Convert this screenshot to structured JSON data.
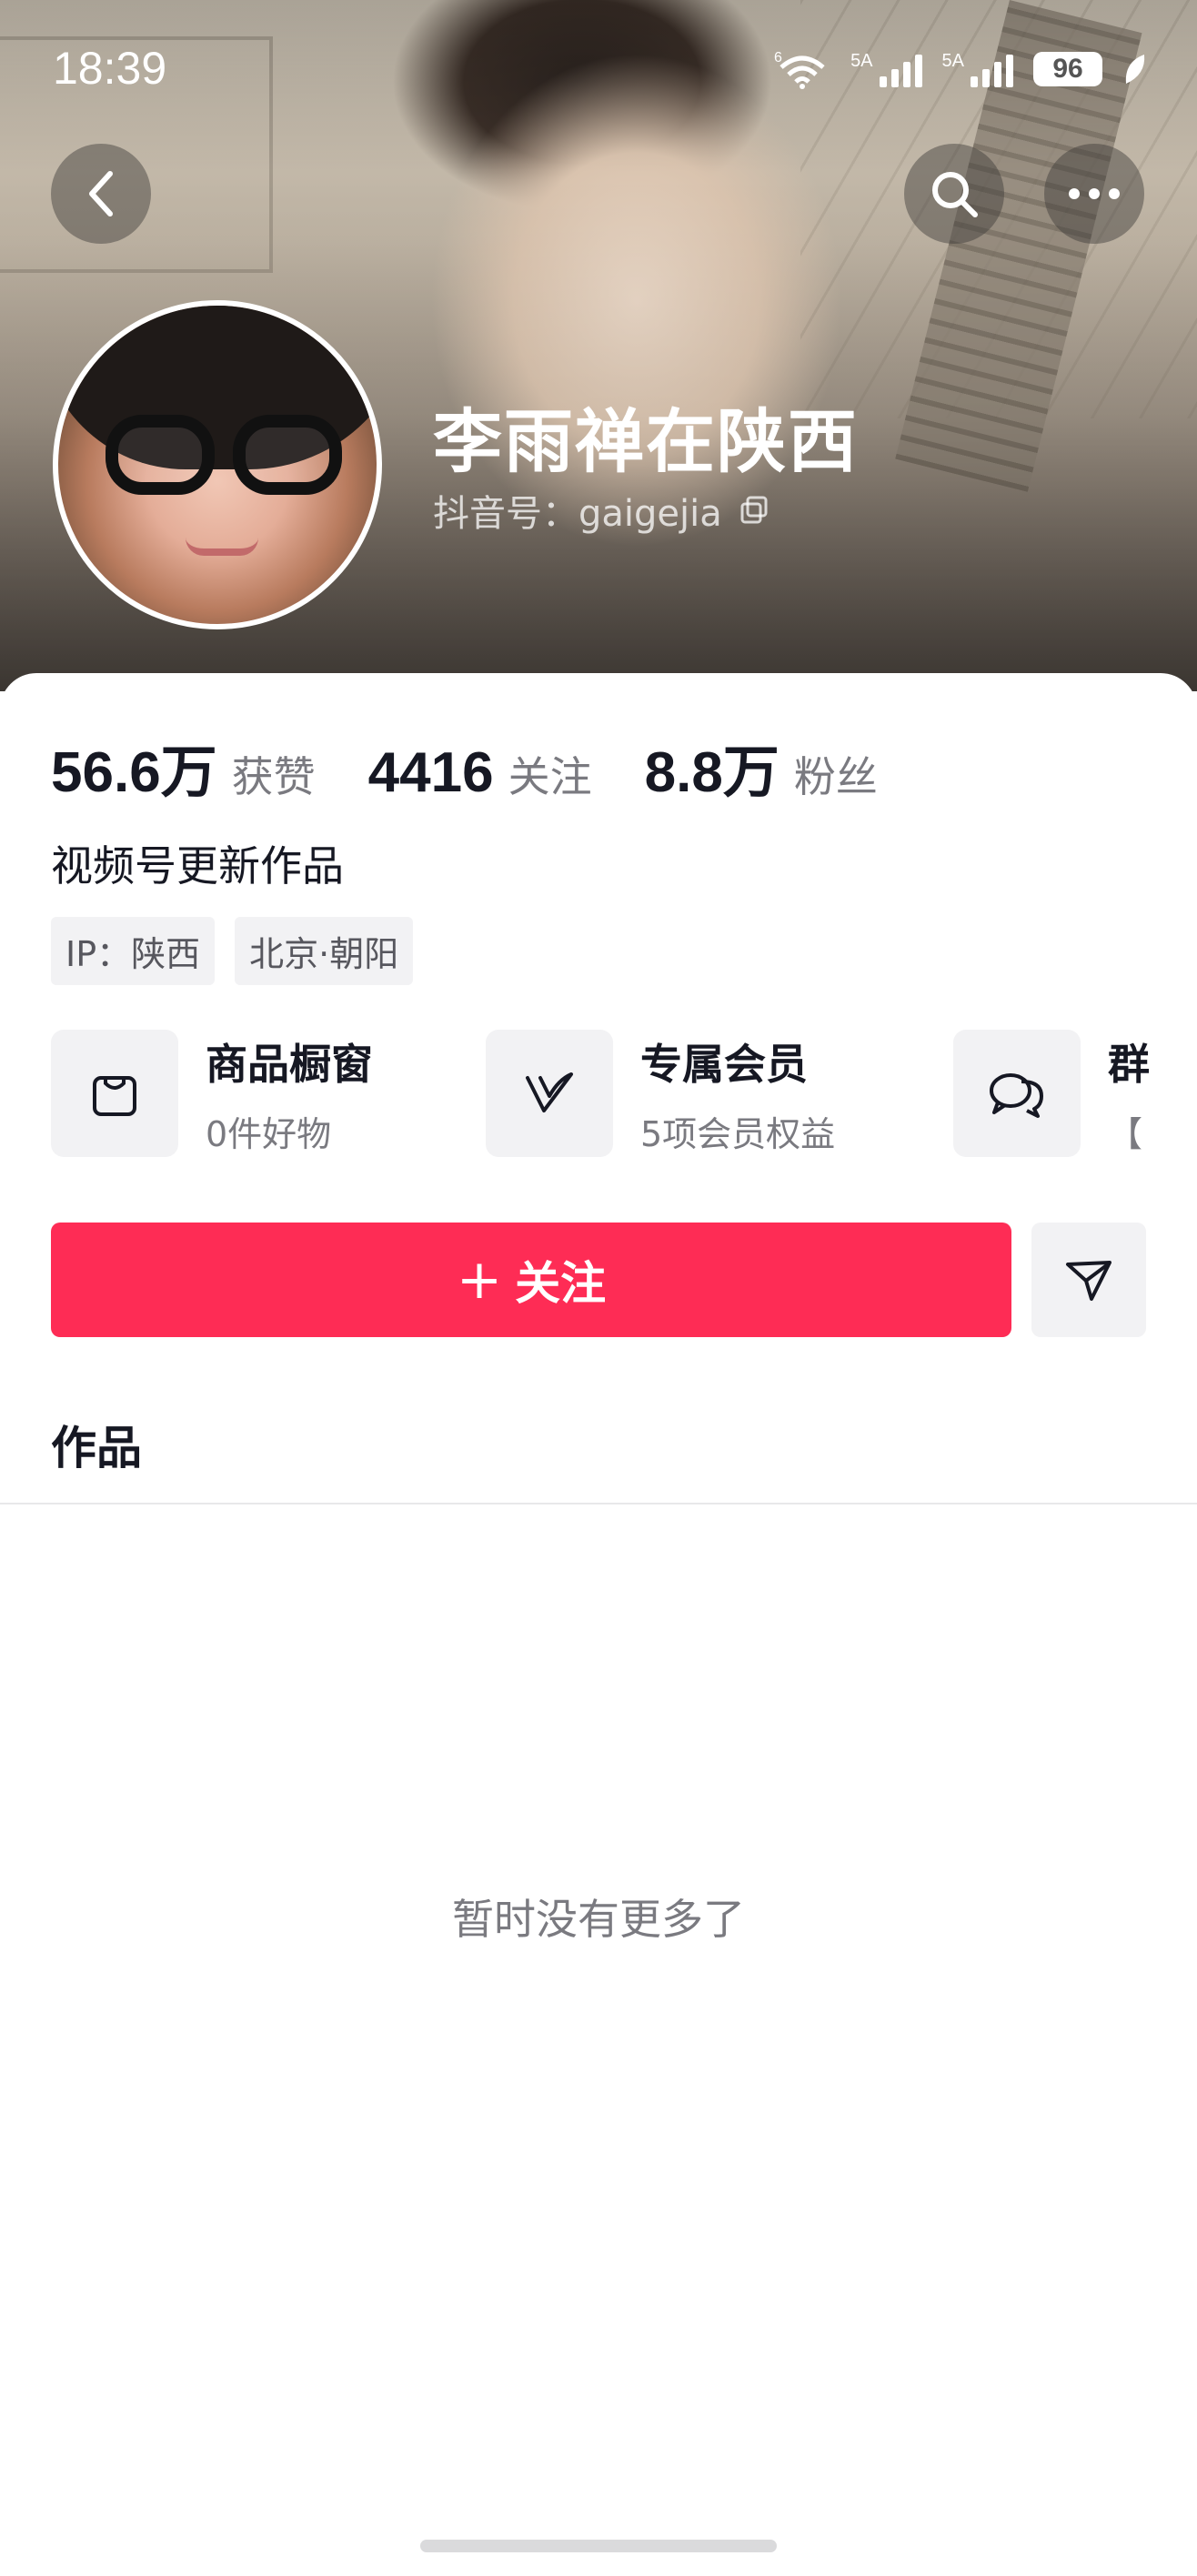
{
  "status_bar": {
    "time": "18:39",
    "wifi_label": "6",
    "signal1_label": "5A",
    "signal2_label": "5A",
    "battery": "96"
  },
  "nav": {
    "back_icon": "back-chevron-icon",
    "search_icon": "search-icon",
    "more_icon": "more-dots-icon"
  },
  "profile": {
    "name": "李雨禅在陕西",
    "handle": "抖音号：gaigejia",
    "copy_icon": "copy-icon"
  },
  "stats": [
    {
      "value": "56.6万",
      "label": "获赞"
    },
    {
      "value": "4416",
      "label": "关注"
    },
    {
      "value": "8.8万",
      "label": "粉丝"
    }
  ],
  "bio": "视频号更新作品",
  "tags": [
    "IP：陕西",
    "北京·朝阳"
  ],
  "features": [
    {
      "title": "商品橱窗",
      "subtitle": "0件好物",
      "icon": "shopping-bag-icon"
    },
    {
      "title": "专属会员",
      "subtitle": "5项会员权益",
      "icon": "member-v-icon"
    },
    {
      "title": "群",
      "subtitle": "【",
      "icon": "group-chat-icon"
    }
  ],
  "actions": {
    "follow_label": "关注",
    "follow_plus": "+",
    "share_icon": "send-icon",
    "follow_color": "#fe2c55"
  },
  "tabs": {
    "works_label": "作品"
  },
  "empty_text": "暂时没有更多了"
}
